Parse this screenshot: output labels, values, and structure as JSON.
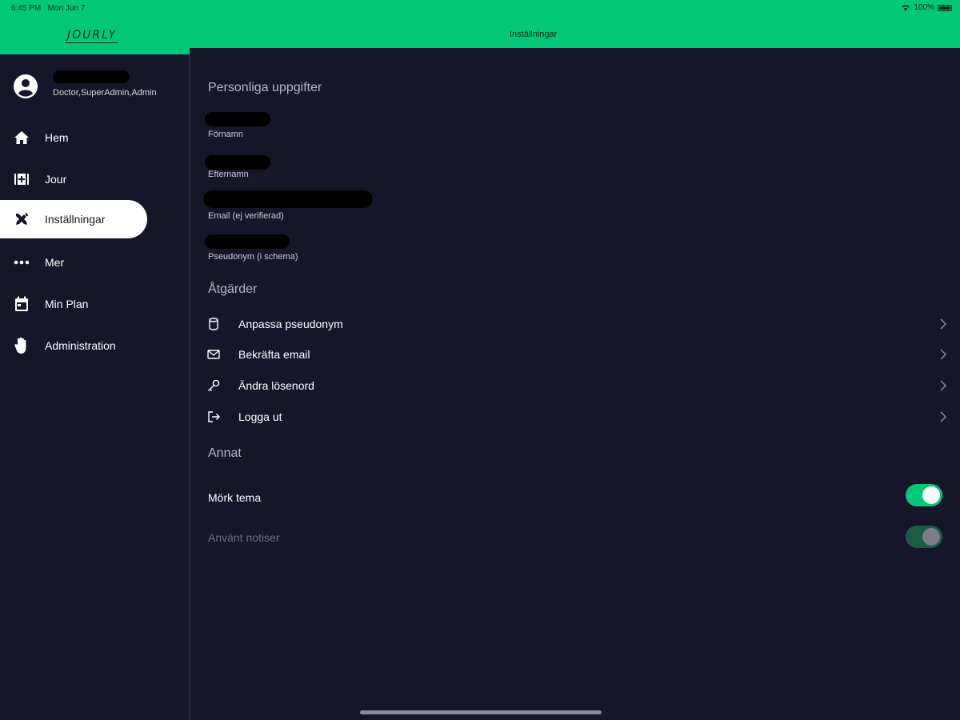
{
  "status_bar": {
    "time": "6:45 PM",
    "date": "Mon Jun 7",
    "battery": "100%"
  },
  "app": {
    "logo": "JOURLY",
    "page_title": "Inställningar"
  },
  "user": {
    "roles": "Doctor,SuperAdmin,Admin"
  },
  "sidebar": {
    "items": [
      {
        "label": "Hem",
        "icon": "home-icon"
      },
      {
        "label": "Jour",
        "icon": "medical-kit-icon"
      },
      {
        "label": "Inställningar",
        "icon": "tools-icon",
        "active": true
      },
      {
        "label": "Mer",
        "icon": "more-icon"
      },
      {
        "label": "Min Plan",
        "icon": "calendar-icon"
      },
      {
        "label": "Administration",
        "icon": "hand-icon"
      }
    ]
  },
  "personal": {
    "title": "Personliga uppgifter",
    "fields": [
      {
        "label": "Förnamn"
      },
      {
        "label": "Efternamn"
      },
      {
        "label": "Email (ej verifierad)"
      },
      {
        "label": "Pseudonym (i schema)"
      }
    ]
  },
  "actions": {
    "title": "Åtgärder",
    "items": [
      {
        "label": "Anpassa pseudonym",
        "icon": "cylinder-icon"
      },
      {
        "label": "Bekräfta email",
        "icon": "mail-icon"
      },
      {
        "label": "Ändra lösenord",
        "icon": "key-icon"
      },
      {
        "label": "Logga ut",
        "icon": "logout-icon"
      }
    ]
  },
  "other": {
    "title": "Annat",
    "settings": [
      {
        "label": "Mörk tema",
        "enabled": true,
        "disabled": false
      },
      {
        "label": "Använt notiser",
        "enabled": true,
        "disabled": true
      }
    ]
  },
  "colors": {
    "accent": "#03c877",
    "background": "#15162a"
  }
}
